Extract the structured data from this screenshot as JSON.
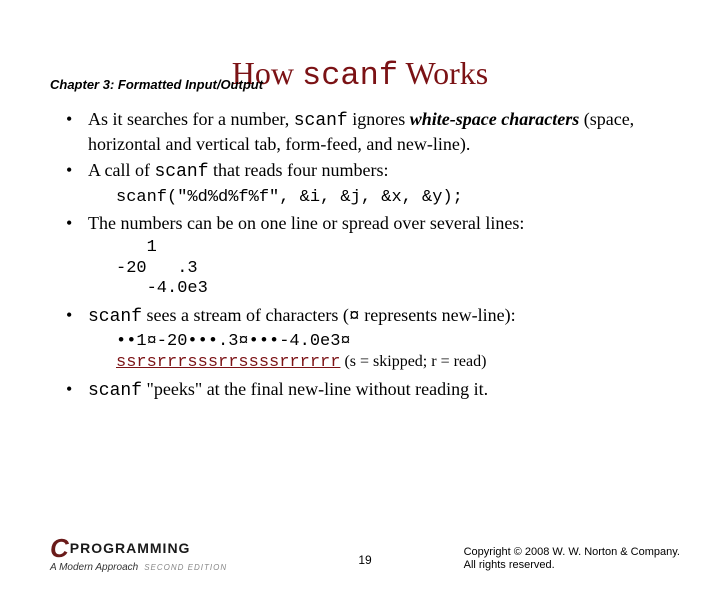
{
  "chapter": "Chapter 3: Formatted Input/Output",
  "title": {
    "pre": "How ",
    "code": "scanf",
    "post": " Works"
  },
  "b1": {
    "t1": "As it searches for a number, ",
    "code": "scanf",
    "t2": " ignores ",
    "em": "white-space characters",
    "t3": " (space, horizontal and vertical tab, form-feed, and new-line)."
  },
  "b2": {
    "t1": "A call of ",
    "code": "scanf",
    "t2": " that reads four numbers:",
    "codeblock": "scanf(\"%d%d%f%f\", &i, &j, &x, &y);"
  },
  "b3": {
    "t1": "The numbers can be on one line or spread over several lines:",
    "codeblock": "   1\n-20   .3\n   -4.0e3"
  },
  "b4": {
    "code": "scanf",
    "t1": " sees a stream of characters (",
    "sym": "¤",
    "t2": " represents new-line):",
    "streamline": "••1¤-20•••.3¤•••-4.0e3¤",
    "srline": "ssrsrrrsssrrssssrrrrrr",
    "legend": {
      "open": " (",
      "s": "s",
      "seq": " = skipped; ",
      "r": "r",
      "req": " = read)"
    }
  },
  "b5": {
    "code": "scanf",
    "t1": " \"peeks\" at the final new-line without reading it."
  },
  "footer": {
    "logo_c": "C",
    "logo_prog": "PROGRAMMING",
    "logo_sub": "A Modern Approach",
    "logo_ed": "SECOND EDITION",
    "page": "19",
    "copy1": "Copyright © 2008 W. W. Norton & Company.",
    "copy2": "All rights reserved."
  }
}
